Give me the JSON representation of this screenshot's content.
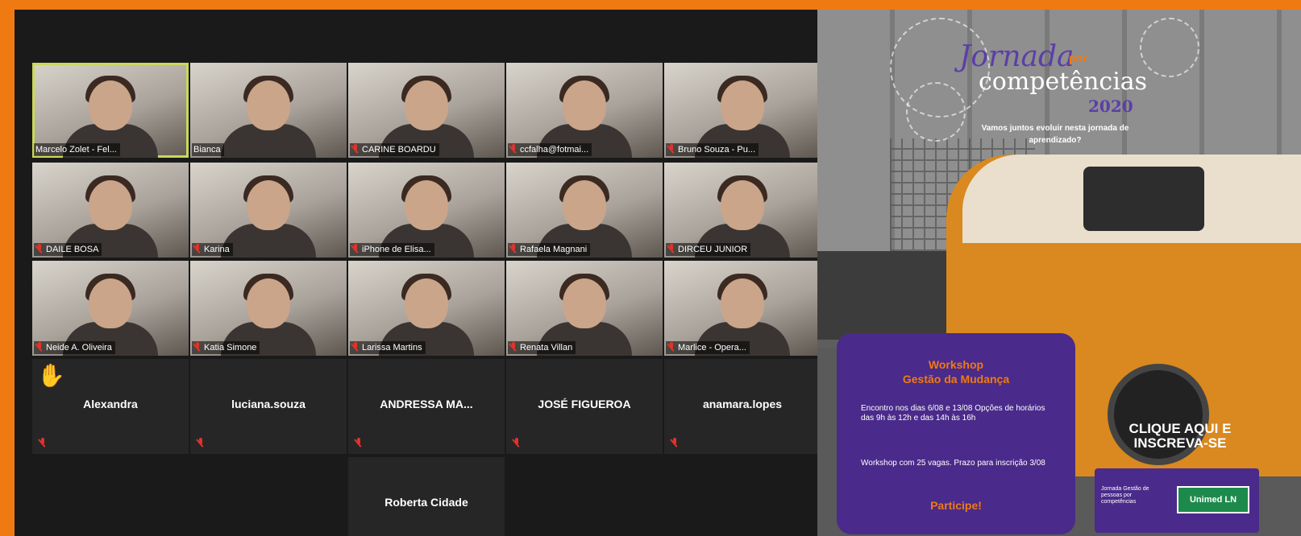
{
  "participants": [
    {
      "name": "Marcelo Zolet - Fel...",
      "video": true,
      "active": true
    },
    {
      "name": "Bianca",
      "video": true
    },
    {
      "name": "CARINE BOARDU",
      "video": true,
      "muted": true
    },
    {
      "name": "ccfalha@fotmai...",
      "video": true,
      "muted": true
    },
    {
      "name": "Bruno Souza - Pu...",
      "video": true,
      "muted": true
    },
    {
      "name": "DAILE BOSA",
      "video": true,
      "muted": true
    },
    {
      "name": "Karina",
      "video": true,
      "muted": true
    },
    {
      "name": "iPhone de Elisa...",
      "video": true,
      "muted": true
    },
    {
      "name": "Rafaela Magnani",
      "video": true,
      "muted": true
    },
    {
      "name": "DIRCEU JUNIOR",
      "video": true,
      "muted": true
    },
    {
      "name": "Neide A. Oliveira",
      "video": true,
      "muted": true
    },
    {
      "name": "Katia Simone",
      "video": true,
      "muted": true
    },
    {
      "name": "Larissa Martins",
      "video": true,
      "muted": true
    },
    {
      "name": "Renata Villan",
      "video": true,
      "muted": true
    },
    {
      "name": "Marlice - Opera...",
      "video": true,
      "muted": true
    },
    {
      "name": "Alexandra",
      "video": false,
      "raised_hand": true
    },
    {
      "name": "luciana.souza",
      "video": false
    },
    {
      "name": "ANDRESSA MA...",
      "video": false
    },
    {
      "name": "JOSÉ FIGUEROA",
      "video": false
    },
    {
      "name": "anamara.lopes",
      "video": false
    },
    {
      "name": "Roberta Cidade",
      "video": false
    }
  ],
  "ad": {
    "title_script": "Jornada",
    "title_connector": "por",
    "title_main": "competências",
    "year": "2020",
    "tagline": "Vamos juntos evoluir nesta jornada de aprendizado?",
    "workshop_title": "Workshop",
    "workshop_subtitle": "Gestão da Mudança",
    "details": "Encontro nos dias 6/08 e 13/08 Opções de horários das 9h às 12h e das 14h às 16h",
    "vagas": "Workshop com 25 vagas. Prazo para inscrição 3/08",
    "cta": "Participe!",
    "clique": "CLIQUE AQUI E INSCREVA-SE",
    "logo_text": "Jornada Gestão de pessoas por competências",
    "logo_brand": "Unimed LN"
  },
  "colors": {
    "border": "#f07a12",
    "purple": "#4a2a8a",
    "active_outline": "#c9d95a",
    "muted_mic": "#e0332b"
  }
}
